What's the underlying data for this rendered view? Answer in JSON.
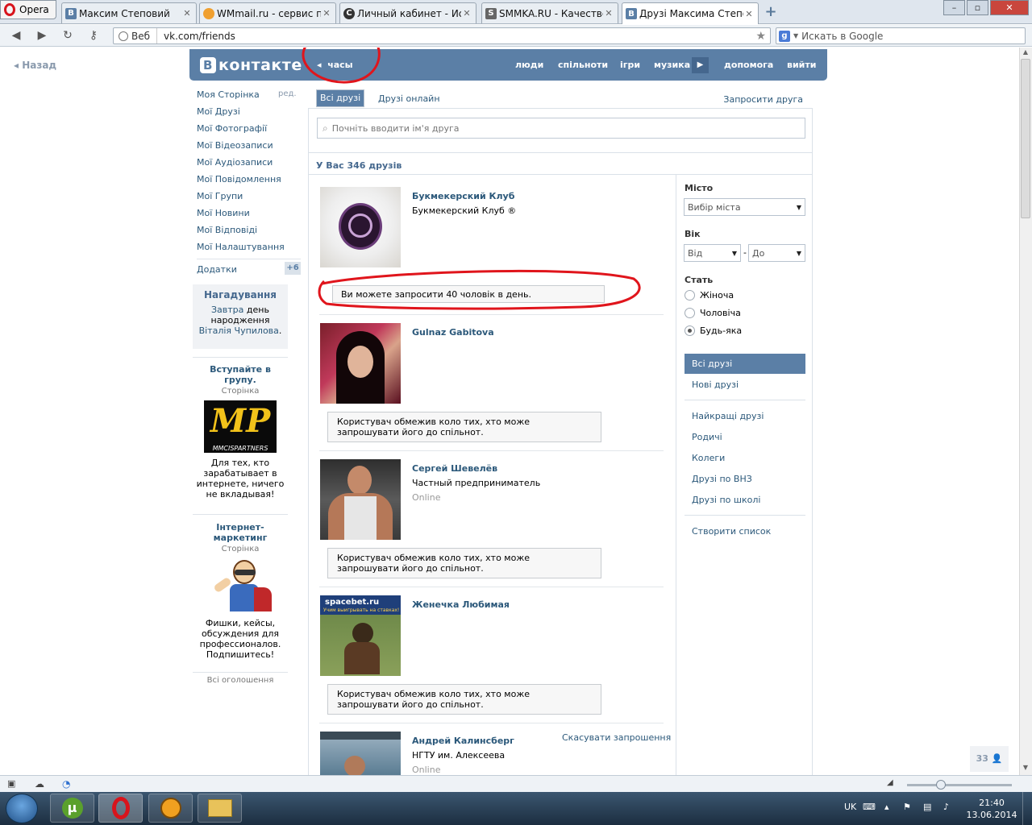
{
  "browser": {
    "menu_label": "Opera",
    "tabs": [
      {
        "label": "Максим Степовий",
        "favicon": "vk"
      },
      {
        "label": "WMmail.ru - сервис п...",
        "favicon": "wmmail"
      },
      {
        "label": "Личный кабинет - Ис...",
        "favicon": "cabinet"
      },
      {
        "label": "SMMKA.RU - Качестве...",
        "favicon": "smmka"
      },
      {
        "label": "Друзі Максима Степо...",
        "favicon": "vk"
      }
    ],
    "address": {
      "mode_label": "Веб",
      "url": "vk.com/friends"
    },
    "search_placeholder": "Искать в Google"
  },
  "page": {
    "back_label": "Назад",
    "header": {
      "logo_text": "контакте",
      "logo_letter": "В",
      "back_link": "часы",
      "nav": [
        "люди",
        "спільноти",
        "ігри",
        "музика",
        "допомога",
        "вийти"
      ]
    },
    "left_menu": {
      "edit_label": "ред.",
      "items": [
        "Моя Сторінка",
        "Мої Друзі",
        "Мої Фотографії",
        "Мої Відеозаписи",
        "Мої Аудіозаписи",
        "Мої Повідомлення",
        "Мої Групи",
        "Мої Новини",
        "Мої Відповіді",
        "Мої Налаштування"
      ],
      "apps_label": "Додатки",
      "apps_badge": "+6"
    },
    "reminder": {
      "title": "Нагадування",
      "link_tomorrow": "Завтра",
      "text1": "день народження",
      "link_name": "Віталія Чупилова",
      "text2": "."
    },
    "ads": [
      {
        "title": "Вступайте в групу.",
        "subtitle": "Сторінка",
        "image_text": "MP",
        "image_caption": "MMCISPARTNERS",
        "desc": "Для тех, кто зарабатывает в интернете, ничего не вкладывая!"
      },
      {
        "title": "Інтернет-маркетинг",
        "subtitle": "Сторінка",
        "desc": "Фишки, кейсы, обсуждения для профессионалов. Подпишитесь!"
      }
    ],
    "all_ads_label": "Всі оголошення",
    "friends": {
      "tabs": [
        "Всі друзі",
        "Друзі онлайн"
      ],
      "invite_label": "Запросити друга",
      "search_placeholder": "Почніть вводити ім'я друга",
      "count_label": "У Вас 346 друзів",
      "list": [
        {
          "name": "Букмекерский Клуб",
          "sub": "Букмекерский Клуб ®",
          "online": "",
          "notice": "Ви можете запросити 40 чоловік в день."
        },
        {
          "name": "Gulnaz Gabitova",
          "sub": "",
          "online": "",
          "notice": "Користувач обмежив коло тих, хто може запрошувати його до спільнот."
        },
        {
          "name": "Сергей Шевелёв",
          "sub": "Частный предприниматель",
          "online": "Online",
          "notice": "Користувач обмежив коло тих, хто може запрошувати його до спільнот."
        },
        {
          "name": "Женечка Любимая",
          "sub": "",
          "online": "",
          "notice": "Користувач обмежив коло тих, хто може запрошувати його до спільнот.",
          "image_brand": "spacebet.ru",
          "image_tagline": "Учим выигрывать на ставках!"
        },
        {
          "name": "Андрей Калинсберг",
          "sub": "НГТУ им. Алексеева",
          "online": "Online",
          "cancel_label": "Скасувати запрошення"
        }
      ]
    },
    "filter": {
      "city_label": "Місто",
      "city_placeholder": "Вибір міста",
      "age_label": "Вік",
      "age_from": "Від",
      "age_dash": "-",
      "age_to": "До",
      "sex_label": "Стать",
      "sex_options": [
        "Жіноча",
        "Чоловіча",
        "Будь-яка"
      ],
      "sex_selected": "Будь-яка",
      "menu": [
        "Всі друзі",
        "Нові друзі",
        "Найкращі друзі",
        "Родичі",
        "Колеги",
        "Друзі по ВНЗ",
        "Друзі по школі",
        "Створити список"
      ],
      "menu_selected": "Всі друзі"
    },
    "counter_badge": "33"
  },
  "taskbar": {
    "lang": "UK",
    "time": "21:40",
    "date": "13.06.2014"
  },
  "colors": {
    "vk_blue": "#5b7fa6",
    "link": "#2b587a",
    "annotation_red": "#e0151c"
  }
}
